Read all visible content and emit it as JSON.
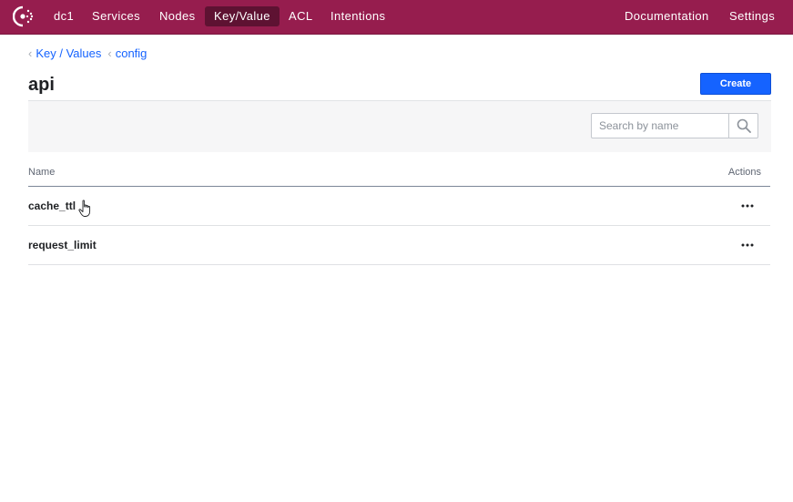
{
  "header": {
    "logo_icon": "consul-logo-icon",
    "datacenter": "dc1",
    "nav": [
      {
        "label": "Services"
      },
      {
        "label": "Nodes"
      },
      {
        "label": "Key/Value",
        "active": true
      },
      {
        "label": "ACL"
      },
      {
        "label": "Intentions"
      }
    ],
    "right_nav": [
      {
        "label": "Documentation"
      },
      {
        "label": "Settings"
      }
    ],
    "bg_color": "#961d4e",
    "active_color": "#5e1232"
  },
  "breadcrumb": [
    {
      "label": "Key / Values"
    },
    {
      "label": "config"
    }
  ],
  "page": {
    "title": "api",
    "create_label": "Create",
    "accent": "#1563ff"
  },
  "search": {
    "placeholder": "Search by name",
    "value": "",
    "icon": "search-icon"
  },
  "table": {
    "columns": [
      "Name",
      "Actions"
    ],
    "rows": [
      {
        "name": "cache_ttl",
        "actions_icon": "more-horizontal-icon"
      },
      {
        "name": "request_limit",
        "actions_icon": "more-horizontal-icon"
      }
    ]
  }
}
